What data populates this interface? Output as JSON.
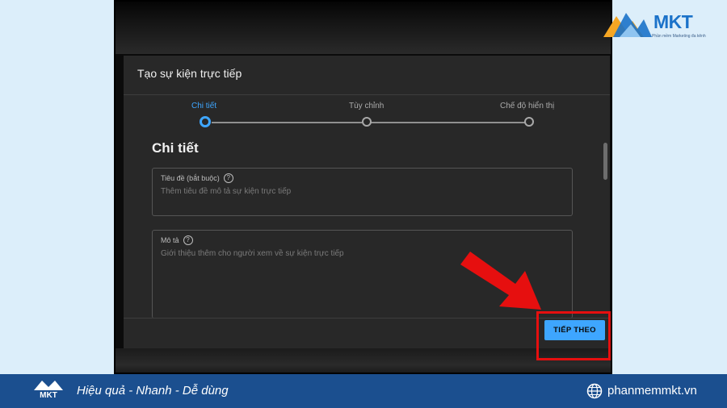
{
  "dialog": {
    "title": "Tạo sự kiện trực tiếp",
    "steps": [
      {
        "label": "Chi tiết",
        "active": true
      },
      {
        "label": "Tùy chỉnh",
        "active": false
      },
      {
        "label": "Chế độ hiển thị",
        "active": false
      }
    ],
    "section_title": "Chi tiết",
    "title_field": {
      "label": "Tiêu đề (bắt buộc)",
      "placeholder": "Thêm tiêu đề mô tả sự kiện trực tiếp"
    },
    "description_field": {
      "label": "Mô tả",
      "placeholder": "Giới thiệu thêm cho người xem về sự kiện trực tiếp"
    },
    "next_button": "TIẾP THEO",
    "help_icon_glyph": "?"
  },
  "branding": {
    "logo_text": "MKT",
    "logo_subtitle": "Phần mềm Marketing đa kênh",
    "tagline": "Hiệu quả - Nhanh - Dễ dùng",
    "website": "phanmemmkt.vn",
    "footer_logo_text": "MKT"
  },
  "colors": {
    "accent": "#3ea6ff",
    "annotation_red": "#e60f0f",
    "footer_bg": "#1b4f8f",
    "dialog_bg": "#282828"
  },
  "icons": [
    "help-icon",
    "globe-icon",
    "red-arrow-annotation"
  ]
}
